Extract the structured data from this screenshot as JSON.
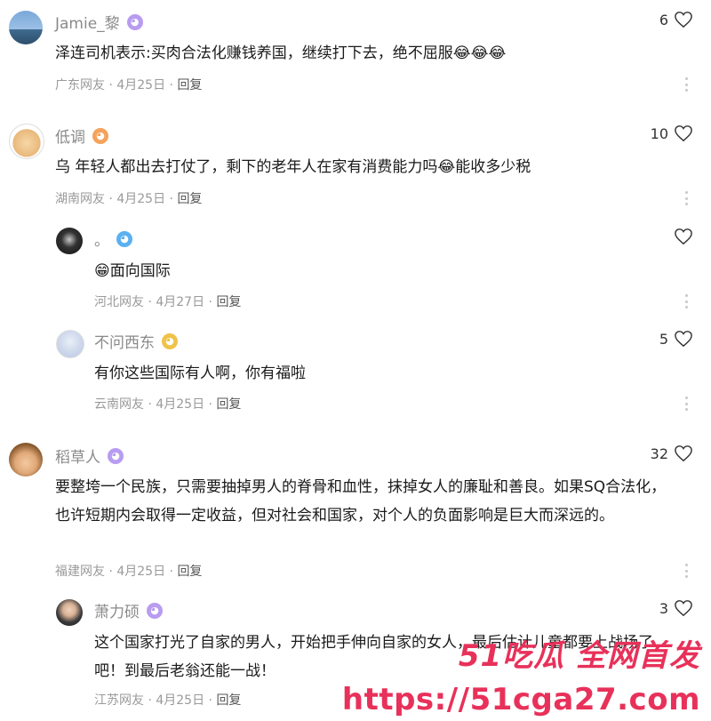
{
  "comments": [
    {
      "name": "Jamie_黎",
      "likes": "6",
      "text": "泽连司机表示:买肉合法化赚钱养国，继续打下去，绝不屈服😂😂😂",
      "meta": "广东网友 · 4月25日 · ",
      "reply": "回复"
    },
    {
      "name": "低调",
      "likes": "10",
      "text": "乌 年轻人都出去打仗了，剩下的老年人在家有消费能力吗😂能收多少税",
      "meta": "湖南网友 · 4月25日 · ",
      "reply": "回复"
    },
    {
      "name": "。",
      "likes": "",
      "text": "😁面向国际",
      "meta": "河北网友 · 4月27日 · ",
      "reply": "回复"
    },
    {
      "name": "不问西东",
      "likes": "5",
      "text": "有你这些国际有人啊，你有福啦",
      "meta": "云南网友 · 4月25日 · ",
      "reply": "回复"
    },
    {
      "name": "稻草人",
      "likes": "32",
      "text": "要整垮一个民族，只需要抽掉男人的脊骨和血性，抹掉女人的廉耻和善良。如果SQ合法化，也许短期内会取得一定收益，但对社会和国家，对个人的负面影响是巨大而深远的。",
      "meta": "福建网友 · 4月25日 · ",
      "reply": "回复"
    },
    {
      "name": "萧力硕",
      "likes": "3",
      "text": "这个国家打光了自家的男人，开始把手伸向自家的女人，最后估计儿童都要上战场了吧！到最后老翁还能一战！",
      "meta": "江苏网友 · 4月25日 · ",
      "reply": "回复"
    }
  ],
  "watermark": {
    "top": "51吃瓜 全网首发",
    "bottom": "https://51cga27.com"
  },
  "icons": {
    "heart": "heart-outline-icon",
    "more": "more-vertical-icon"
  },
  "colors": {
    "accent": "#e8315a",
    "meta": "#9a9a9a",
    "name": "#8a8a8a"
  }
}
